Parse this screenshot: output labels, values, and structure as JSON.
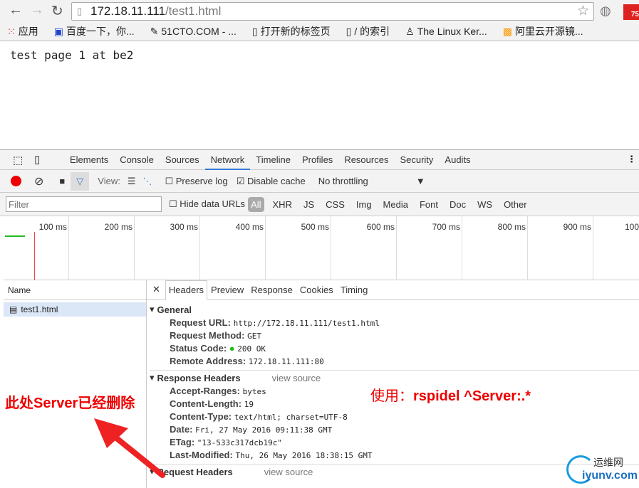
{
  "browser": {
    "url_host": "172.18.11.111",
    "url_path": "/test1.html",
    "bookmarks": [
      "应用",
      "百度一下，你...",
      "51CTO.COM - ...",
      "打开新的标签页",
      "/ 的索引",
      "The Linux Ker...",
      "阿里云开源镜..."
    ],
    "ext_badge": "75"
  },
  "page": {
    "text": "test page 1 at be2"
  },
  "devtools": {
    "tabs": [
      "Elements",
      "Console",
      "Sources",
      "Network",
      "Timeline",
      "Profiles",
      "Resources",
      "Security",
      "Audits"
    ],
    "view_label": "View:",
    "preserve_log": "Preserve log",
    "disable_cache": "Disable cache",
    "throttling": "No throttling",
    "filter_placeholder": "Filter",
    "hide_data_urls": "Hide data URLs",
    "types": [
      "All",
      "XHR",
      "JS",
      "CSS",
      "Img",
      "Media",
      "Font",
      "Doc",
      "WS",
      "Other"
    ],
    "ticks": [
      "100 ms",
      "200 ms",
      "300 ms",
      "400 ms",
      "500 ms",
      "600 ms",
      "700 ms",
      "800 ms",
      "900 ms",
      "100"
    ],
    "name_header": "Name",
    "request": "test1.html",
    "detail_tabs": [
      "Headers",
      "Preview",
      "Response",
      "Cookies",
      "Timing"
    ],
    "general": {
      "title": "General",
      "rows": [
        [
          "Request URL:",
          "http://172.18.11.111/test1.html"
        ],
        [
          "Request Method:",
          "GET"
        ],
        [
          "Status Code:",
          "200 OK"
        ],
        [
          "Remote Address:",
          "172.18.11.111:80"
        ]
      ]
    },
    "response_headers": {
      "title": "Response Headers",
      "view_source": "view source",
      "rows": [
        [
          "Accept-Ranges:",
          "bytes"
        ],
        [
          "Content-Length:",
          "19"
        ],
        [
          "Content-Type:",
          "text/html; charset=UTF-8"
        ],
        [
          "Date:",
          "Fri, 27 May 2016 09:11:38 GMT"
        ],
        [
          "ETag:",
          "\"13-533c317dcb19c\""
        ],
        [
          "Last-Modified:",
          "Thu, 26 May 2016 18:38:15 GMT"
        ]
      ]
    },
    "request_headers": {
      "title": "Request Headers",
      "view_source": "view source"
    }
  },
  "annotations": {
    "left": "此处Server已经删除",
    "left_bold": "Server",
    "right_prefix": "使用：",
    "right_cmd": "rspidel ^Server:.*"
  },
  "watermark": {
    "cn": "运维网",
    "en": "iyunv.com"
  }
}
